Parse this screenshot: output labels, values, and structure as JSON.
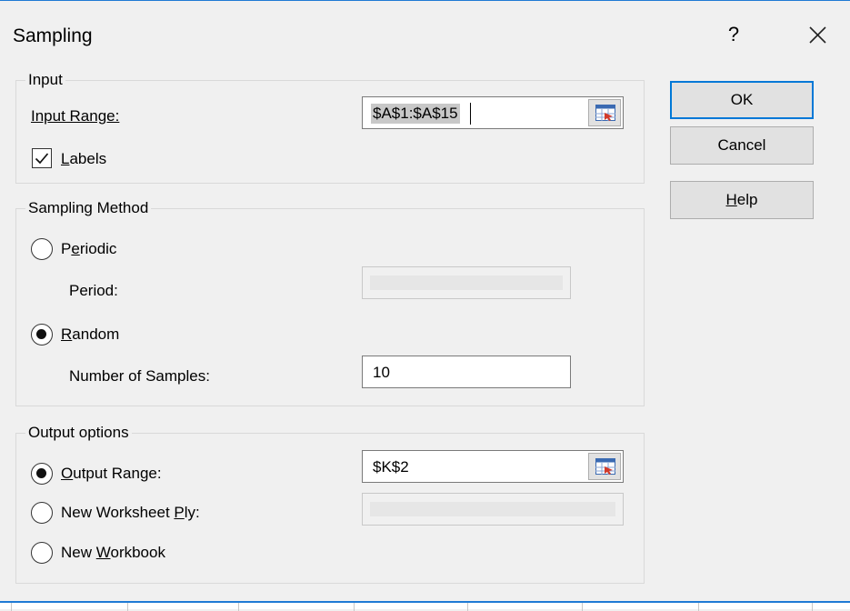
{
  "window": {
    "title": "Sampling",
    "help_glyph": "?",
    "close_icon": "close-icon"
  },
  "input_group": {
    "title": "Input",
    "input_range_label": "Input Range:",
    "input_range_value": "$A$1:$A$15",
    "labels_checkbox": {
      "label": "abels",
      "mnemonic": "L",
      "checked": true
    }
  },
  "sampling_method": {
    "title": "Sampling Method",
    "periodic": {
      "mnemonic_prefix": "P",
      "mnemonic": "e",
      "rest": "riodic",
      "selected": false
    },
    "period_label": "Period:",
    "period_value": "",
    "random": {
      "mnemonic": "R",
      "rest": "andom",
      "selected": true
    },
    "num_samples_label": "Number of Samples:",
    "num_samples_value": "10"
  },
  "output_options": {
    "title": "Output options",
    "output_range": {
      "mnemonic": "O",
      "rest": "utput Range:",
      "selected": true
    },
    "output_range_value": "$K$2",
    "new_worksheet": {
      "prefix": "New Worksheet ",
      "mnemonic": "P",
      "rest": "ly:",
      "selected": false
    },
    "new_worksheet_value": "",
    "new_workbook": {
      "prefix": "New ",
      "mnemonic": "W",
      "rest": "orkbook",
      "selected": false
    }
  },
  "buttons": {
    "ok": "OK",
    "cancel": "Cancel",
    "help_mnemonic": "H",
    "help_rest": "elp"
  },
  "colors": {
    "accent": "#0078d7",
    "background": "#f0f0f0",
    "field_bg": "#ffffff",
    "border": "#7a7a7a"
  }
}
